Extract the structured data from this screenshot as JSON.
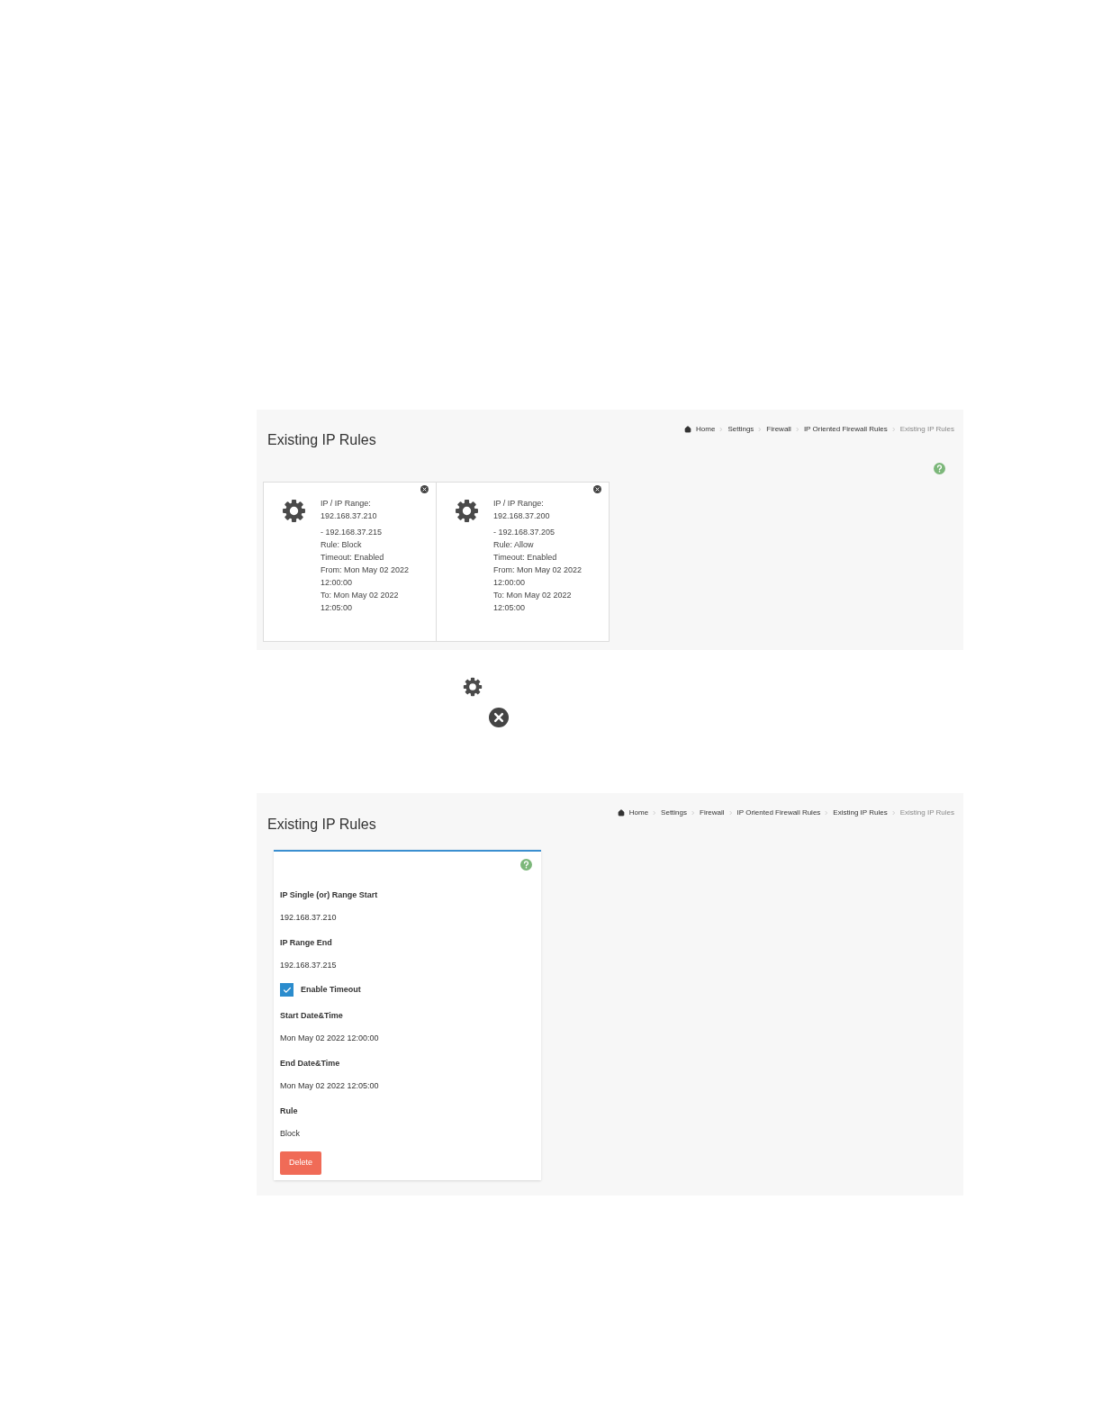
{
  "rules_screen": {
    "title": "Existing IP Rules",
    "breadcrumb": [
      {
        "label": "Home",
        "selected": false
      },
      {
        "label": "Settings",
        "selected": false
      },
      {
        "label": "Firewall",
        "selected": false
      },
      {
        "label": "IP Oriented Firewall Rules",
        "selected": false
      },
      {
        "label": "Existing IP Rules",
        "selected": true
      }
    ],
    "rule_cards": [
      {
        "heading": "IP / IP Range:",
        "range_start": "192.168.37.210",
        "lines": [
          "- 192.168.37.215",
          "Rule: Block",
          "Timeout: Enabled",
          "From: Mon May 02 2022",
          "12:00:00",
          "To: Mon May 02 2022",
          "12:05:00"
        ]
      },
      {
        "heading": "IP / IP Range:",
        "range_start": "192.168.37.200",
        "lines": [
          "- 192.168.37.205",
          "Rule: Allow",
          "Timeout: Enabled",
          "From: Mon May 02 2022",
          "12:00:00",
          "To: Mon May 02 2022",
          "12:05:00"
        ]
      }
    ]
  },
  "detail_screen": {
    "title": "Existing IP Rules",
    "breadcrumb": [
      {
        "label": "Home",
        "selected": false
      },
      {
        "label": "Settings",
        "selected": false
      },
      {
        "label": "Firewall",
        "selected": false
      },
      {
        "label": "IP Oriented Firewall Rules",
        "selected": false
      },
      {
        "label": "Existing IP Rules",
        "selected": false
      },
      {
        "label": "Existing IP Rules",
        "selected": true
      }
    ],
    "fields": [
      {
        "kind": "text",
        "label": "IP Single (or) Range Start",
        "value": "192.168.37.210"
      },
      {
        "kind": "text",
        "label": "IP Range End",
        "value": "192.168.37.215"
      },
      {
        "kind": "checkbox",
        "label": "Enable Timeout",
        "checked": true
      },
      {
        "kind": "text",
        "label": "Start Date&Time",
        "value": "Mon May 02 2022 12:00:00"
      },
      {
        "kind": "text",
        "label": "End Date&Time",
        "value": "Mon May 02 2022 12:05:00"
      },
      {
        "kind": "text",
        "label": "Rule",
        "value": "Block"
      }
    ],
    "delete_button": "Delete"
  }
}
